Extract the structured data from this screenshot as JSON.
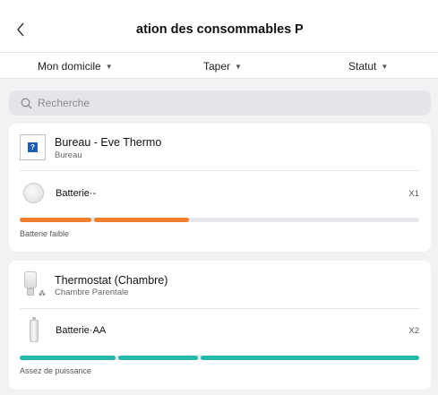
{
  "header": {
    "title": "ation des consommables",
    "title_suffix": "P"
  },
  "filters": [
    {
      "label": "Mon domicile"
    },
    {
      "label": "Taper"
    },
    {
      "label": "Statut"
    }
  ],
  "search": {
    "placeholder": "Recherche"
  },
  "colors": {
    "low": "#f07f2e",
    "ok": "#24b9a9",
    "track": "#e8e8ec"
  },
  "devices": [
    {
      "name": "Bureau - Eve Thermo",
      "room": "Bureau",
      "icon": "eve-thermo-unknown-icon",
      "battery_label": "Batterie·-",
      "battery_icon": "coin-cell-battery-icon",
      "quantity": "X1",
      "level_segments_filled": 2,
      "level_segments_total": 5,
      "status": "Batterie faible",
      "status_color": "#f07f2e"
    },
    {
      "name": "Thermostat (Chambre)",
      "room": "Chambre Parentale",
      "icon": "radiator-thermostat-icon",
      "battery_label": "Batterie·AA",
      "battery_icon": "aa-battery-icon",
      "quantity": "X2",
      "level_segments_filled": 3,
      "level_segments_total": 3,
      "status": "Assez de puissance",
      "status_color": "#24b9a9"
    }
  ]
}
